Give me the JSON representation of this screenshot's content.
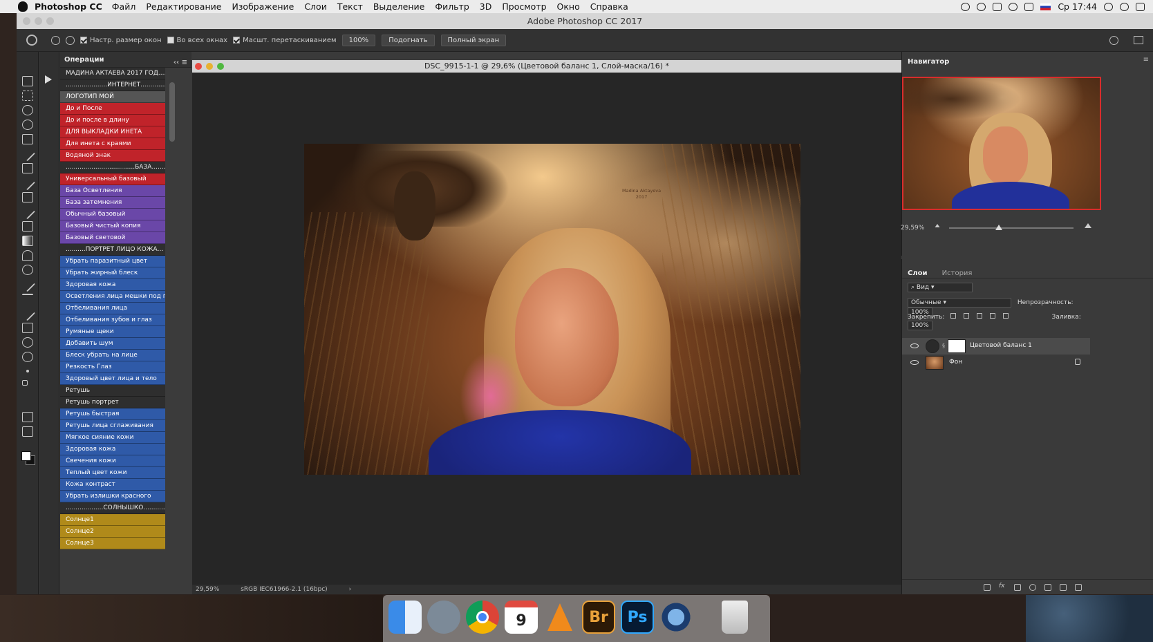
{
  "menubar": {
    "app_name": "Photoshop CC",
    "items": [
      "Файл",
      "Редактирование",
      "Изображение",
      "Слои",
      "Текст",
      "Выделение",
      "Фильтр",
      "3D",
      "Просмотр",
      "Окно",
      "Справка"
    ],
    "clock": "Ср 17:44"
  },
  "window": {
    "title": "Adobe Photoshop CC 2017"
  },
  "options_bar": {
    "resize_windows": "Настр. размер окон",
    "all_windows": "Во всех окнах",
    "scrubby_zoom": "Масшт. перетаскиванием",
    "zoom_value": "100%",
    "fit_button": "Подогнать",
    "fullscreen_button": "Полный экран"
  },
  "actions_panel": {
    "title": "Операции",
    "items": [
      {
        "label": "МАДИНА АКТАЕВА 2017  ГОД......",
        "color": "none"
      },
      {
        "label": ".....................ИНТЕРНЕТ...............",
        "color": "none"
      },
      {
        "label": "ЛОГОТИП МОЙ",
        "color": "gray"
      },
      {
        "label": "До и После",
        "color": "red"
      },
      {
        "label": "До и после в длину",
        "color": "red"
      },
      {
        "label": "ДЛЯ ВЫКЛАДКИ ИНЕТА",
        "color": "red"
      },
      {
        "label": "Для инета с краями",
        "color": "red"
      },
      {
        "label": "Водяной знак",
        "color": "red"
      },
      {
        "label": "...................................БАЗА.........",
        "color": "none"
      },
      {
        "label": "Универсальный базовый",
        "color": "red"
      },
      {
        "label": "База Осветления",
        "color": "violet"
      },
      {
        "label": "База затемнения",
        "color": "violet"
      },
      {
        "label": "Обычный базовый",
        "color": "violet"
      },
      {
        "label": "Базовый чистый копия",
        "color": "violet"
      },
      {
        "label": "Базовый световой",
        "color": "violet"
      },
      {
        "label": "..........ПОРТРЕТ ЛИЦО КОЖА...",
        "color": "none"
      },
      {
        "label": "Убрать паразитный цвет",
        "color": "blue"
      },
      {
        "label": "Убрать жирный блеск",
        "color": "blue"
      },
      {
        "label": "Здоровая кожа",
        "color": "blue"
      },
      {
        "label": "Осветления лица мешки под г...",
        "color": "blue"
      },
      {
        "label": "Отбеливания лица",
        "color": "blue"
      },
      {
        "label": "Отбеливания зубов и глаз",
        "color": "blue"
      },
      {
        "label": "Румяные щеки",
        "color": "blue"
      },
      {
        "label": "Добавить шум",
        "color": "blue"
      },
      {
        "label": "Блеск убрать на лице",
        "color": "blue"
      },
      {
        "label": "Резкость Глаз",
        "color": "blue"
      },
      {
        "label": "Здоровый цвет лица и тело",
        "color": "blue"
      },
      {
        "label": "Ретушь",
        "color": "none"
      },
      {
        "label": "Ретушь портрет",
        "color": "none"
      },
      {
        "label": "Ретушь быстрая",
        "color": "blue"
      },
      {
        "label": "Ретушь лица сглаживания",
        "color": "blue"
      },
      {
        "label": "Мягкое сияние кожи",
        "color": "blue"
      },
      {
        "label": "Здоровая кожа",
        "color": "blue"
      },
      {
        "label": "Свечения кожи",
        "color": "blue"
      },
      {
        "label": "Теплый цвет кожи",
        "color": "blue"
      },
      {
        "label": "Кожа  контраст",
        "color": "blue"
      },
      {
        "label": "Убрать излишки красного",
        "color": "blue"
      },
      {
        "label": "...................СОЛНЫШКО...........",
        "color": "none"
      },
      {
        "label": "Солнце1",
        "color": "yellow"
      },
      {
        "label": "Солнце2",
        "color": "yellow"
      },
      {
        "label": "Солнце3",
        "color": "yellow"
      }
    ]
  },
  "document": {
    "title": "DSC_9915-1-1 @ 29,6% (Цветовой баланс 1, Слой-маска/16) *",
    "watermark_line1": "Madina Aktayeva",
    "watermark_line2": "2017",
    "status_zoom": "29,59%",
    "status_profile": "sRGB IEC61966-2.1 (16bpc)"
  },
  "navigator": {
    "title": "Навигатор",
    "zoom": "29,59%",
    "slider_fraction": 0.4
  },
  "layers_panel": {
    "tab_layers": "Слои",
    "tab_history": "История",
    "filter": "Вид",
    "blend_mode": "Обычные",
    "opacity_label": "Непрозрачность:",
    "opacity_value": "100%",
    "lock_label": "Закрепить:",
    "fill_label": "Заливка:",
    "fill_value": "100%",
    "layers": [
      {
        "name": "Цветовой баланс 1",
        "selected": true
      },
      {
        "name": "Фон",
        "selected": false
      }
    ]
  },
  "dock": {
    "items": [
      {
        "name": "finder-icon"
      },
      {
        "name": "launchpad-icon"
      },
      {
        "name": "chrome-icon"
      },
      {
        "name": "calendar-icon",
        "label": "9"
      },
      {
        "name": "vlc-icon"
      },
      {
        "name": "bridge-icon",
        "label": "Br"
      },
      {
        "name": "photoshop-icon",
        "label": "Ps"
      },
      {
        "name": "quicktime-icon"
      },
      {
        "name": "trash-icon"
      }
    ]
  },
  "colors": {
    "red": "#c0232a",
    "violet": "#6a47a8",
    "blue": "#2f5aa8",
    "yellow": "#b08a1a",
    "nav_frame": "#d92c2c"
  }
}
